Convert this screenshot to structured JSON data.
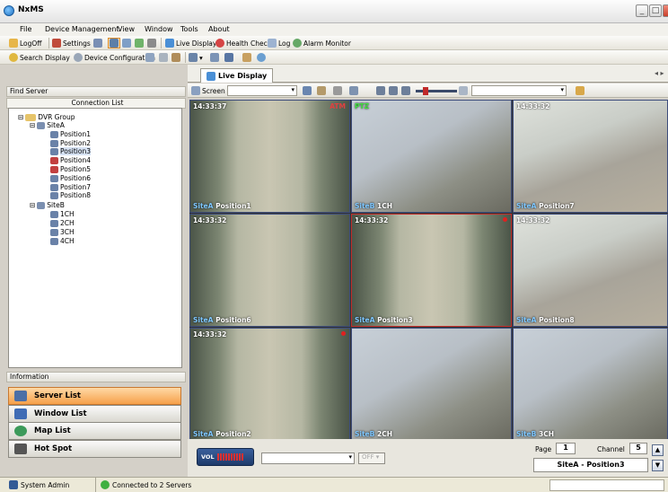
{
  "app": {
    "title": "NxMS"
  },
  "menu": [
    "File",
    "Device Management",
    "View",
    "Window",
    "Tools",
    "About"
  ],
  "toolbar1": {
    "logoff": "LogOff",
    "settings": "Settings",
    "live_display": "Live Display",
    "health_check": "Health Check",
    "log": "Log",
    "alarm_monitor": "Alarm Monitor"
  },
  "toolbar2": {
    "search_display": "Search Display",
    "device_configuration": "Device Configuration"
  },
  "left_panel": {
    "find_server": "Find Server",
    "connection_list": "Connection List",
    "tree": {
      "root": "DVR Group",
      "sites": [
        {
          "name": "SiteA",
          "children": [
            "Position1",
            "Position2",
            "Position3",
            "Position4",
            "Position5",
            "Position6",
            "Position7",
            "Position8"
          ]
        },
        {
          "name": "SiteB",
          "children": [
            "1CH",
            "2CH",
            "3CH",
            "4CH"
          ]
        }
      ]
    },
    "information": "Information",
    "nav": [
      "Server List",
      "Window List",
      "Map List",
      "Hot Spot"
    ]
  },
  "live": {
    "tab_label": "Live Display",
    "screen_label": "Screen",
    "cameras": [
      {
        "time": "14:33:37",
        "alarm": "ATM",
        "site": "SiteA",
        "name": "Position1",
        "scene": "hall"
      },
      {
        "time": "",
        "alarm": "PTZ",
        "site": "SiteB",
        "name": "1CH",
        "scene": "office"
      },
      {
        "time": "14:33:32",
        "alarm": "",
        "site": "SiteA",
        "name": "Position7",
        "scene": "room"
      },
      {
        "time": "14:33:32",
        "alarm": "",
        "site": "SiteA",
        "name": "Position6",
        "scene": "hall"
      },
      {
        "time": "14:33:32",
        "alarm": "",
        "site": "SiteA",
        "name": "Position3",
        "scene": "hall"
      },
      {
        "time": "14:33:32",
        "alarm": "",
        "site": "SiteA",
        "name": "Position8",
        "scene": "room"
      },
      {
        "time": "14:33:32",
        "alarm": "",
        "site": "SiteA",
        "name": "Position2",
        "scene": "hall"
      },
      {
        "time": "",
        "alarm": "",
        "site": "SiteB",
        "name": "2CH",
        "scene": "office"
      },
      {
        "time": "",
        "alarm": "",
        "site": "SiteB",
        "name": "3CH",
        "scene": "office"
      }
    ]
  },
  "bottom": {
    "vol_label": "VOL",
    "off_label": "OFF",
    "page_label": "Page",
    "page_value": "1",
    "channel_label": "Channel",
    "channel_value": "5",
    "selected_camera": "SiteA - Position3"
  },
  "status": {
    "user": "System Admin",
    "connection": "Connected to 2 Servers"
  }
}
